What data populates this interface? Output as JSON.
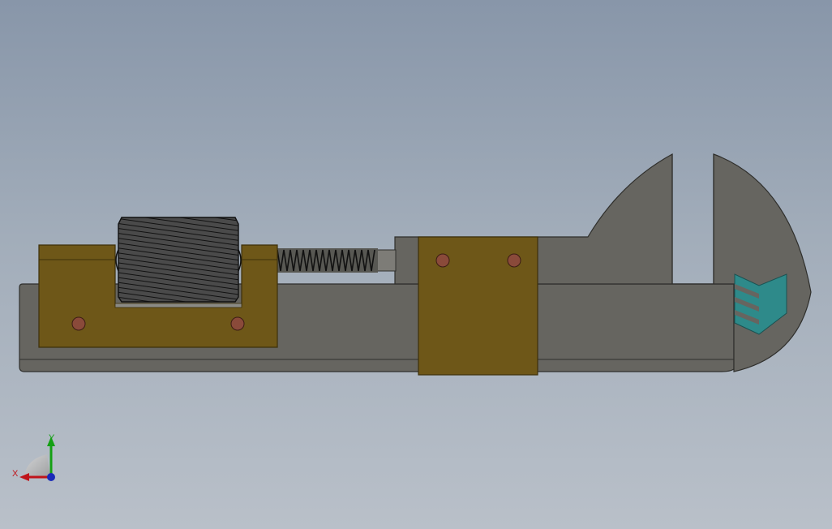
{
  "viewport": {
    "background_top": "#8896a9",
    "background_bottom": "#b9c0c9"
  },
  "colors": {
    "body_gray": "#666560",
    "body_edge": "#3a3a36",
    "brass": "#6e5718",
    "brass_edge": "#3d300a",
    "rivet": "#8a4a3a",
    "knurl": "#2a2a2a",
    "spring": "#333333",
    "logo_teal": "#2e8a8a",
    "axis_x": "#c0141a",
    "axis_y": "#14a014",
    "axis_z": "#1a2ab8"
  },
  "triad": {
    "x_label": "X",
    "y_label": "Y"
  },
  "icons": [
    "adjustable-wrench-model",
    "logo-chevron-icon",
    "coordinate-triad-icon"
  ]
}
